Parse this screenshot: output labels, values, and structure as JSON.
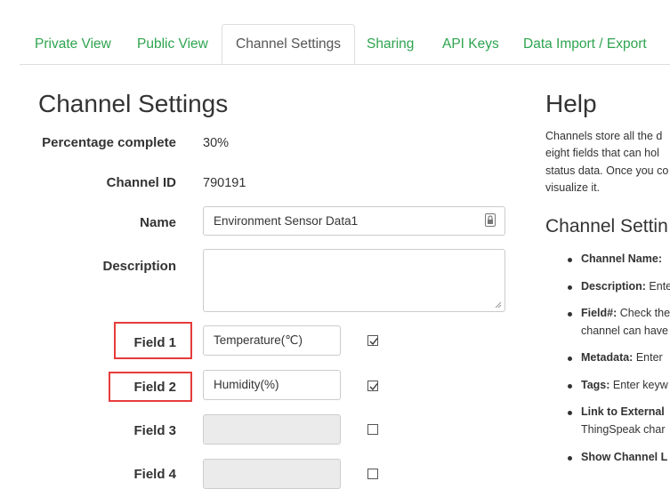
{
  "tabs": [
    {
      "label": "Private View"
    },
    {
      "label": "Public View"
    },
    {
      "label": "Channel Settings"
    },
    {
      "label": "Sharing"
    },
    {
      "label": "API Keys"
    },
    {
      "label": "Data Import / Export"
    }
  ],
  "main": {
    "title": "Channel Settings",
    "percentage_label": "Percentage complete",
    "percentage_value": "30%",
    "channel_id_label": "Channel ID",
    "channel_id_value": "790191",
    "name_label": "Name",
    "name_value": "Environment Sensor Data1",
    "description_label": "Description",
    "description_value": "",
    "fields": [
      {
        "label": "Field 1",
        "value": "Temperature(℃)",
        "checked": true
      },
      {
        "label": "Field 2",
        "value": "Humidity(%)",
        "checked": true
      },
      {
        "label": "Field 3",
        "value": "",
        "checked": false
      },
      {
        "label": "Field 4",
        "value": "",
        "checked": false
      }
    ]
  },
  "help": {
    "title": "Help",
    "lines": [
      "Channels store all the d",
      "eight fields that can hol",
      "status data. Once you co",
      "visualize it."
    ],
    "settings_title": "Channel Settin",
    "bullets": [
      {
        "bold": "Channel Name:",
        "text": " "
      },
      {
        "bold": "Description:",
        "text": " Ente"
      },
      {
        "bold": "Field#:",
        "text": " Check the"
      },
      {
        "bold": "",
        "text": "channel can have"
      },
      {
        "bold": "Metadata:",
        "text": " Enter"
      },
      {
        "bold": "Tags:",
        "text": " Enter keyw"
      },
      {
        "bold": "Link to External",
        "text": ""
      },
      {
        "bold": "",
        "text": "ThingSpeak char"
      },
      {
        "bold": "Show Channel L",
        "text": ""
      }
    ]
  },
  "colors": {
    "tab_link": "#2ea44f",
    "highlight_box": "#e63b3b"
  },
  "icons": {
    "name_field_icon": "lock-icon",
    "checkbox_mark": "check-icon"
  }
}
